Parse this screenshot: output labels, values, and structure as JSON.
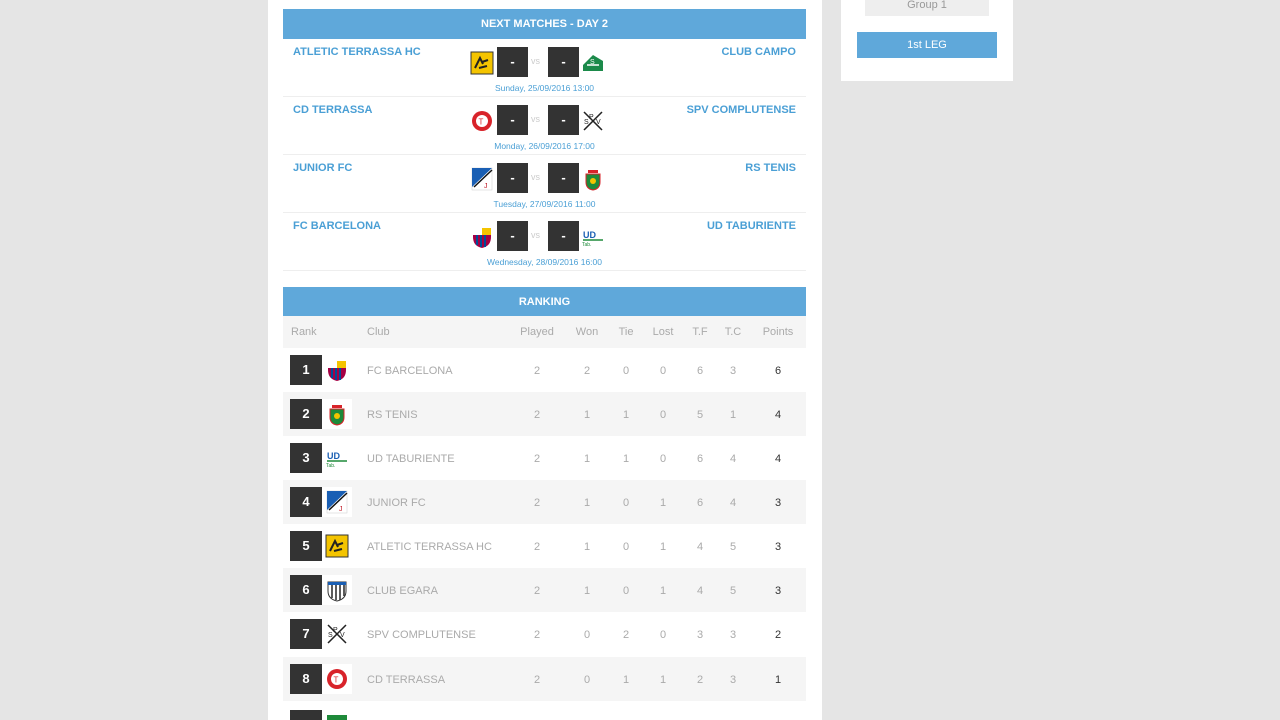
{
  "sidebar": {
    "group_label": "Group 1",
    "leg_label": "1st LEG"
  },
  "next_matches": {
    "title": "NEXT MATCHES - DAY 2",
    "vs_label": "vs",
    "matches": [
      {
        "home": "ATLETIC TERRASSA HC",
        "away": "CLUB CAMPO",
        "home_score": "-",
        "away_score": "-",
        "date": "Sunday, 25/09/2016 13:00",
        "home_crest": "atletic-terrassa-crest-icon",
        "away_crest": "club-campo-crest-icon"
      },
      {
        "home": "CD TERRASSA",
        "away": "SPV COMPLUTENSE",
        "home_score": "-",
        "away_score": "-",
        "date": "Monday, 26/09/2016 17:00",
        "home_crest": "cd-terrassa-crest-icon",
        "away_crest": "spv-complutense-crest-icon"
      },
      {
        "home": "JUNIOR FC",
        "away": "RS TENIS",
        "home_score": "-",
        "away_score": "-",
        "date": "Tuesday, 27/09/2016 11:00",
        "home_crest": "junior-fc-crest-icon",
        "away_crest": "rs-tenis-crest-icon"
      },
      {
        "home": "FC BARCELONA",
        "away": "UD TABURIENTE",
        "home_score": "-",
        "away_score": "-",
        "date": "Wednesday, 28/09/2016 16:00",
        "home_crest": "fc-barcelona-crest-icon",
        "away_crest": "ud-taburiente-crest-icon"
      }
    ]
  },
  "ranking": {
    "title": "RANKING",
    "columns": {
      "rank": "Rank",
      "club": "Club",
      "played": "Played",
      "won": "Won",
      "tie": "Tie",
      "lost": "Lost",
      "tf": "T.F",
      "tc": "T.C",
      "points": "Points"
    },
    "rows": [
      {
        "pos": "1",
        "club": "FC BARCELONA",
        "played": "2",
        "won": "2",
        "tie": "0",
        "lost": "0",
        "tf": "6",
        "tc": "3",
        "points": "6"
      },
      {
        "pos": "2",
        "club": "RS TENIS",
        "played": "2",
        "won": "1",
        "tie": "1",
        "lost": "0",
        "tf": "5",
        "tc": "1",
        "points": "4"
      },
      {
        "pos": "3",
        "club": "UD TABURIENTE",
        "played": "2",
        "won": "1",
        "tie": "1",
        "lost": "0",
        "tf": "6",
        "tc": "4",
        "points": "4"
      },
      {
        "pos": "4",
        "club": "JUNIOR FC",
        "played": "2",
        "won": "1",
        "tie": "0",
        "lost": "1",
        "tf": "6",
        "tc": "4",
        "points": "3"
      },
      {
        "pos": "5",
        "club": "ATLETIC TERRASSA HC",
        "played": "2",
        "won": "1",
        "tie": "0",
        "lost": "1",
        "tf": "4",
        "tc": "5",
        "points": "3"
      },
      {
        "pos": "6",
        "club": "CLUB EGARA",
        "played": "2",
        "won": "1",
        "tie": "0",
        "lost": "1",
        "tf": "4",
        "tc": "5",
        "points": "3"
      },
      {
        "pos": "7",
        "club": "SPV COMPLUTENSE",
        "played": "2",
        "won": "0",
        "tie": "2",
        "lost": "0",
        "tf": "3",
        "tc": "3",
        "points": "2"
      },
      {
        "pos": "8",
        "club": "CD TERRASSA",
        "played": "2",
        "won": "0",
        "tie": "1",
        "lost": "1",
        "tf": "2",
        "tc": "3",
        "points": "1"
      }
    ]
  },
  "colors": {
    "accent": "#5fa8da",
    "link": "#4a9fd5",
    "dark_box": "#333333"
  }
}
